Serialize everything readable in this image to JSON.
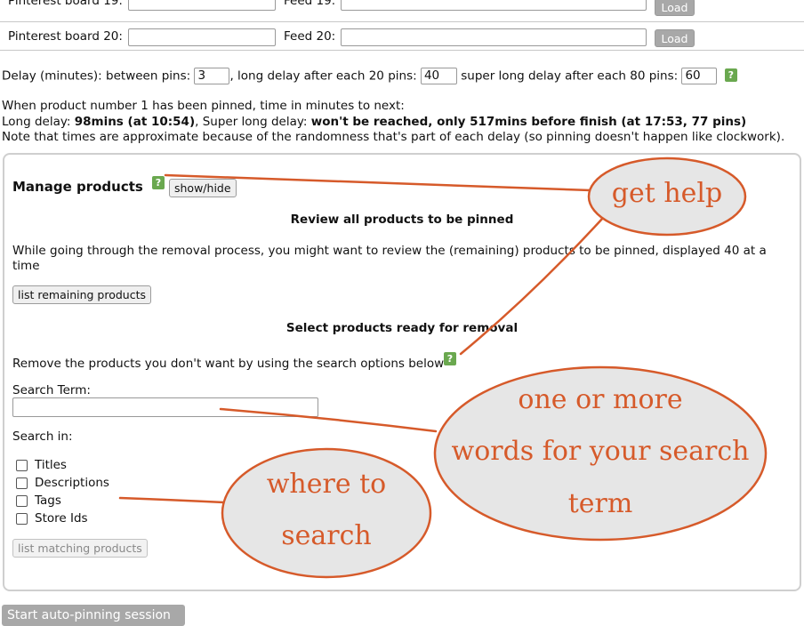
{
  "boards": [
    {
      "board_label": "Pinterest board 19:",
      "board_value": "",
      "feed_label": "Feed 19:",
      "feed_value": "",
      "load_label": "Load"
    },
    {
      "board_label": "Pinterest board 20:",
      "board_value": "",
      "feed_label": "Feed 20:",
      "feed_value": "",
      "load_label": "Load"
    }
  ],
  "delay": {
    "prefix": "Delay (minutes): between pins:",
    "between_value": "3",
    "long_label": ", long delay after each 20 pins:",
    "long_value": "40",
    "super_label": "super long delay after each 80 pins:",
    "super_value": "60",
    "help": "?"
  },
  "info": {
    "line1": "When product number 1 has been pinned, time in minutes to next:",
    "long_label": "Long delay:",
    "long_value": "98mins (at 10:54)",
    "super_label": ", Super long delay:",
    "super_value": "won't be reached, only 517mins before finish (at 17:53, 77 pins)",
    "note": "Note that times are approximate because of the randomness that's part of each delay (so pinning doesn't happen like clockwork)."
  },
  "manage": {
    "title": "Manage products",
    "help": "?",
    "toggle_label": "show/hide",
    "review_heading": "Review all products to be pinned",
    "review_text_1": "While going through the removal process, you might want to review the (remaining) products to be pinned, displayed 40 at a",
    "review_text_2": "time",
    "list_remaining_label": "list remaining products",
    "select_heading": "Select products ready for removal",
    "remove_text": "Remove the products you don't want by using the search options below",
    "remove_help": "?",
    "search_term_label": "Search Term:",
    "search_term_value": "",
    "search_in_label": "Search in:",
    "options": [
      {
        "label": "Titles",
        "checked": false
      },
      {
        "label": "Descriptions",
        "checked": false
      },
      {
        "label": "Tags",
        "checked": false
      },
      {
        "label": "Store Ids",
        "checked": false
      }
    ],
    "list_matching_label": "list matching products"
  },
  "start_label": "Start auto-pinning session",
  "annotations": {
    "get_help": "get help",
    "search_term_line1": "one or more",
    "search_term_line2": "words for your search",
    "search_term_line3": "term",
    "where_line1": "where to",
    "where_line2": "search",
    "color": "#d65a2a",
    "fill": "#e6e6e6"
  }
}
